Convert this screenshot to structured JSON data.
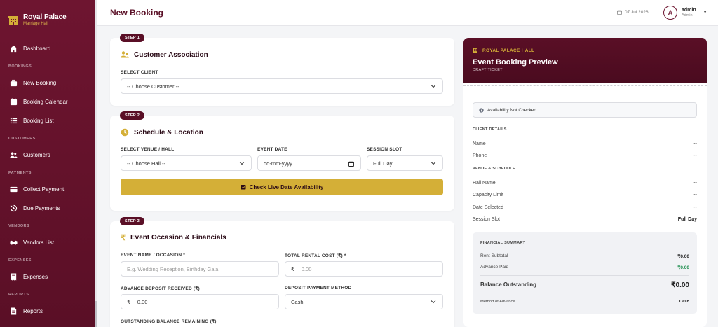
{
  "brand": {
    "name": "Royal Palace",
    "subtitle": "Marriage Hall"
  },
  "nav": {
    "dashboard": "Dashboard",
    "sections": {
      "bookings": "BOOKINGS",
      "customers": "CUSTOMERS",
      "payments": "PAYMENTS",
      "vendors": "VENDORS",
      "expenses": "EXPENSES",
      "reports": "REPORTS"
    },
    "new_booking": "New Booking",
    "booking_calendar": "Booking Calendar",
    "booking_list": "Booking List",
    "customers": "Customers",
    "collect_payment": "Collect Payment",
    "due_payments": "Due Payments",
    "vendors_list": "Vendors List",
    "expenses": "Expenses",
    "reports": "Reports"
  },
  "header": {
    "title": "New Booking",
    "date": "07 Jul 2026",
    "avatar_letter": "A",
    "user_name": "admin",
    "user_role": "Admin"
  },
  "step1": {
    "badge": "STEP 1",
    "title": "Customer Association",
    "client_label": "SELECT CLIENT",
    "client_value": "-- Choose Customer --"
  },
  "step2": {
    "badge": "STEP 2",
    "title": "Schedule & Location",
    "venue_label": "SELECT VENUE / HALL",
    "venue_value": "-- Choose Hall --",
    "date_label": "EVENT DATE",
    "date_value": "dd-mm-yyyy",
    "slot_label": "SESSION SLOT",
    "slot_value": "Full Day",
    "check_button": "Check Live Date Availability"
  },
  "step3": {
    "badge": "STEP 3",
    "title": "Event Occasion & Financials",
    "event_label": "EVENT NAME / OCCASION *",
    "event_placeholder": "E.g. Wedding Reception, Birthday Gala",
    "rental_label": "TOTAL RENTAL COST (₹) *",
    "rental_placeholder": "0.00",
    "currency": "₹",
    "deposit_label": "ADVANCE DEPOSIT RECEIVED (₹)",
    "deposit_value": "0.00",
    "method_label": "DEPOSIT PAYMENT METHOD",
    "method_value": "Cash",
    "balance_label": "OUTSTANDING BALANCE REMAINING (₹)"
  },
  "preview": {
    "brand": "ROYAL PALACE HALL",
    "title": "Event Booking Preview",
    "subtitle": "DRAFT TICKET",
    "availability": "Availability Not Checked",
    "client_section": "CLIENT DETAILS",
    "name_label": "Name",
    "name_value": "--",
    "phone_label": "Phone",
    "phone_value": "--",
    "venue_section": "VENUE & SCHEDULE",
    "hall_label": "Hall Name",
    "hall_value": "--",
    "capacity_label": "Capacity Limit",
    "capacity_value": "--",
    "date_label": "Date Selected",
    "date_value": "--",
    "slot_label": "Session Slot",
    "slot_value": "Full Day",
    "financial_section": "FINANCIAL SUMMARY",
    "rent_label": "Rent Subtotal",
    "rent_value": "₹0.00",
    "advance_label": "Advance Paid",
    "advance_value": "₹0.00",
    "balance_label": "Balance Outstanding",
    "balance_value": "₹0.00",
    "method_label": "Method of Advance",
    "method_value": "Cash"
  },
  "colors": {
    "primary": "#5a0f26",
    "gold": "#d4af37",
    "green": "#1e8e4e"
  }
}
